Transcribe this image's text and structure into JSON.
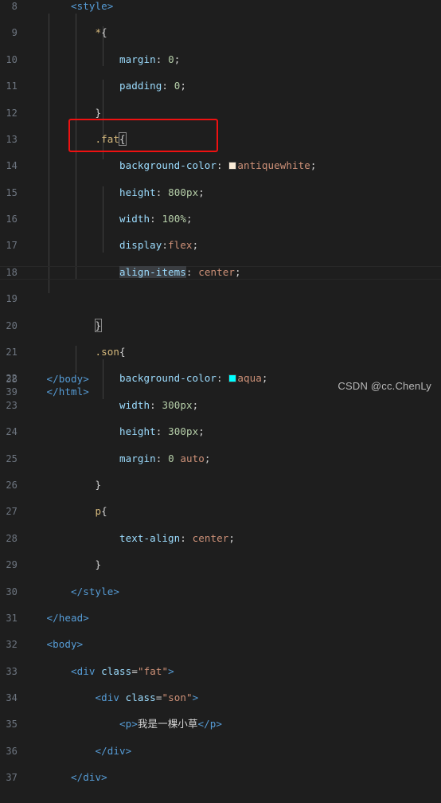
{
  "editor": {
    "theme": "dark-plus",
    "background": "#1e1e1e",
    "gutter_color": "#6e7681",
    "current_line": 18,
    "selected_word": "align-items",
    "colors": {
      "tag": "#569cd6",
      "selector": "#d7ba7d",
      "property": "#9cdcfe",
      "value": "#ce9178",
      "number": "#b5cea8",
      "punctuation": "#d4d4d4",
      "string": "#ce9178",
      "selection_bg": "#3a3d41",
      "indent_guide": "#404040",
      "annotation_box": "#ee1111"
    },
    "color_swatches": {
      "antiquewhite": "#faebd7",
      "aqua": "#00ffff"
    }
  },
  "lines": [
    {
      "num": "8",
      "indent": 2,
      "text": "<style>"
    },
    {
      "num": "9",
      "indent": 3,
      "text": "*{"
    },
    {
      "num": "10",
      "indent": 4,
      "text": "margin: 0;"
    },
    {
      "num": "11",
      "indent": 4,
      "text": "padding: 0;"
    },
    {
      "num": "12",
      "indent": 3,
      "text": "}"
    },
    {
      "num": "13",
      "indent": 3,
      "text": ".fat{"
    },
    {
      "num": "14",
      "indent": 4,
      "text": "background-color: antiquewhite;"
    },
    {
      "num": "15",
      "indent": 4,
      "text": "height: 800px;"
    },
    {
      "num": "16",
      "indent": 4,
      "text": "width: 100%;"
    },
    {
      "num": "17",
      "indent": 4,
      "text": "display:flex;"
    },
    {
      "num": "18",
      "indent": 4,
      "text": "align-items: center;"
    },
    {
      "num": "19",
      "indent": 0,
      "text": ""
    },
    {
      "num": "20",
      "indent": 3,
      "text": "}"
    },
    {
      "num": "21",
      "indent": 3,
      "text": ".son{"
    },
    {
      "num": "22",
      "indent": 4,
      "text": "background-color: aqua;"
    },
    {
      "num": "23",
      "indent": 4,
      "text": "width: 300px;"
    },
    {
      "num": "24",
      "indent": 4,
      "text": "height: 300px;"
    },
    {
      "num": "25",
      "indent": 4,
      "text": "margin: 0 auto;"
    },
    {
      "num": "26",
      "indent": 3,
      "text": "}"
    },
    {
      "num": "27",
      "indent": 3,
      "text": "p{"
    },
    {
      "num": "28",
      "indent": 4,
      "text": "text-align: center;"
    },
    {
      "num": "29",
      "indent": 3,
      "text": "}"
    },
    {
      "num": "30",
      "indent": 2,
      "text": "</style>"
    },
    {
      "num": "31",
      "indent": 1,
      "text": "</head>"
    },
    {
      "num": "32",
      "indent": 1,
      "text": "<body>"
    },
    {
      "num": "33",
      "indent": 2,
      "text": "<div class=\"fat\">"
    },
    {
      "num": "34",
      "indent": 3,
      "text": "<div class=\"son\">"
    },
    {
      "num": "35",
      "indent": 4,
      "text": "<p>我是一棵小草</p>"
    },
    {
      "num": "36",
      "indent": 3,
      "text": "</div>"
    },
    {
      "num": "37",
      "indent": 2,
      "text": "</div>"
    },
    {
      "num": "38",
      "indent": 1,
      "text": "</body>"
    },
    {
      "num": "39",
      "indent": 1,
      "text": "</html>"
    }
  ],
  "tokens": {
    "style_open": "<style>",
    "style_close": "</style>",
    "head_close": "</head>",
    "body_open": "<body>",
    "body_close": "</body>",
    "html_close": "</html>",
    "universal_sel": "*",
    "fat_sel": ".fat",
    "son_sel": ".son",
    "p_sel": "p",
    "prop_margin": "margin",
    "prop_padding": "padding",
    "prop_bgcolor": "background-color",
    "prop_height": "height",
    "prop_width": "width",
    "prop_display": "display",
    "prop_align_items": "align-items",
    "prop_text_align": "text-align",
    "val_zero": "0",
    "val_antiquewhite": "antiquewhite",
    "val_aqua": "aqua",
    "val_800px": "800px",
    "val_100pct": "100%",
    "val_300px": "300px",
    "val_flex": "flex",
    "val_center": "center",
    "val_auto": "auto",
    "attr_class": "class",
    "str_fat": "\"fat\"",
    "str_son": "\"son\"",
    "tag_div_open": "<div",
    "tag_div_close": "</div>",
    "tag_p_open": "<p>",
    "tag_p_close": "</p>",
    "paragraph_text": "我是一棵小草",
    "brace_open": "{",
    "brace_close": "}",
    "colon": ":",
    "semicolon": ";",
    "gt": ">"
  },
  "annotation": {
    "box_label": "red-highlight-box",
    "covers_lines": [
      "17",
      "18"
    ]
  },
  "watermark": {
    "text": "CSDN @cc.ChenLy"
  }
}
